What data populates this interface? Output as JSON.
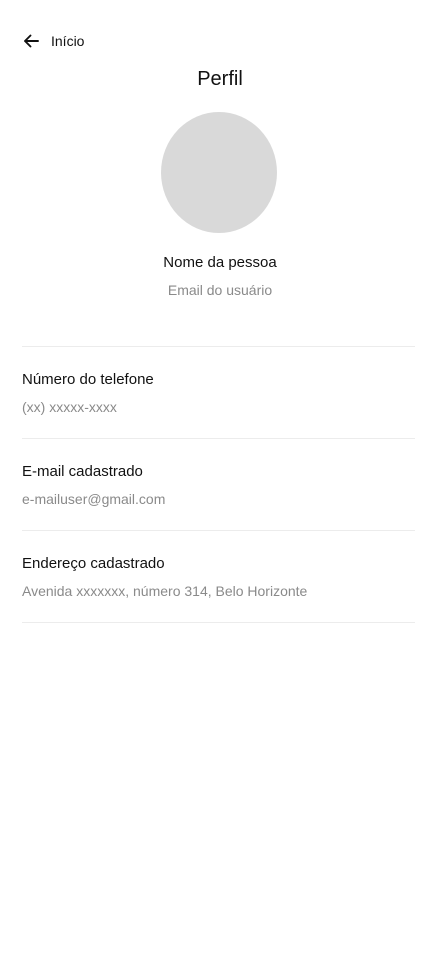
{
  "header": {
    "back_label": "Início",
    "title": "Perfil"
  },
  "profile": {
    "name": "Nome da pessoa",
    "email": "Email do usuário"
  },
  "fields": [
    {
      "label": "Número do telefone",
      "value": "(xx) xxxxx-xxxx"
    },
    {
      "label": "E-mail cadastrado",
      "value": "e-mailuser@gmail.com"
    },
    {
      "label": "Endereço cadastrado",
      "value": "Avenida xxxxxxx, número 314, Belo Horizonte"
    }
  ],
  "icons": {
    "back": "arrow-left-icon"
  }
}
